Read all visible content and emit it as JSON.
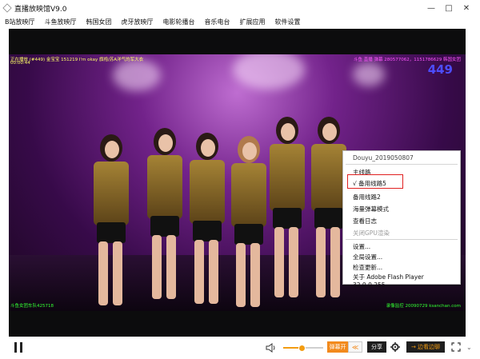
{
  "window": {
    "title": "直播放映馆V9.0",
    "controls": [
      "—",
      "□",
      "✕"
    ]
  },
  "menu": [
    "B站放映厅",
    "斗鱼放映厅",
    "韩国女团",
    "虎牙放映厅",
    "电影轮播台",
    "音乐电台",
    "扩展应用",
    "软件设置"
  ],
  "overlay": {
    "room": "正在播放 (#449) 金宝宝 151219 I'm okay 旗袍/苏A洋气的军大衣",
    "time": "00:00:44",
    "top_right": "斗鱼 直播 弹幕 280577062，1151786629 韩国女团",
    "count": "449",
    "bottom_left": "斗鱼女团车队425718",
    "bottom_right": "录像监控 20090729 ksanchan.com"
  },
  "context_menu": {
    "header": "Douyu_2019050807",
    "items": [
      {
        "label": "主线路",
        "disabled": false
      },
      {
        "label": "√ 备用线路5",
        "disabled": false,
        "highlighted": true
      },
      {
        "label": "备用线路2",
        "disabled": false
      },
      {
        "label": "海量弹幕模式",
        "disabled": false
      },
      {
        "label": "查看日志",
        "disabled": false
      },
      {
        "label": "关闭GPU渲染",
        "disabled": true
      },
      {
        "label": "设置...",
        "disabled": false
      },
      {
        "label": "全局设置...",
        "disabled": false
      },
      {
        "label": "检查更新...",
        "disabled": false
      },
      {
        "label": "关于 Adobe Flash Player 32.0.0.255...",
        "disabled": false
      }
    ]
  },
  "controls": {
    "danmu": "弹幕开",
    "collapse": "≪",
    "share": "分享",
    "record": "→ 边看边聊",
    "volume_level": 0.45
  },
  "colors": {
    "accent": "#f28a1d",
    "highlight_border": "#e02020",
    "count": "#4d4dff"
  }
}
